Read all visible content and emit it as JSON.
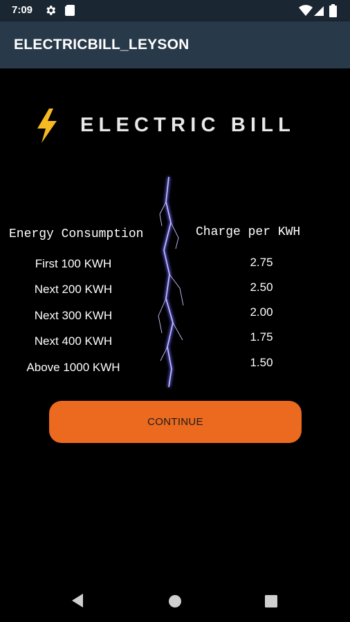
{
  "status_bar": {
    "time": "7:09",
    "icons": [
      "gear-icon",
      "sd-card-icon",
      "wifi-icon",
      "signal-icon",
      "battery-icon"
    ]
  },
  "app_bar": {
    "title": "ELECTRICBILL_LEYSON"
  },
  "header": {
    "title": "ELECTRIC BILL",
    "icon": "lightning-bolt-icon",
    "icon_color": "#f5b921"
  },
  "rates": {
    "energy_header": "Energy Consumption",
    "charge_header": "Charge per KWH",
    "rows": [
      {
        "energy": "First 100 KWH",
        "charge": "2.75"
      },
      {
        "energy": "Next 200 KWH",
        "charge": "2.50"
      },
      {
        "energy": "Next 300 KWH",
        "charge": "2.00"
      },
      {
        "energy": "Next 400 KWH",
        "charge": "1.75"
      },
      {
        "energy": "Above 1000 KWH",
        "charge": "1.50"
      }
    ]
  },
  "continue_button": {
    "label": "CONTINUE",
    "color": "#ec6a1f"
  },
  "nav_bar": {
    "items": [
      "back-icon",
      "home-icon",
      "recents-icon"
    ]
  }
}
